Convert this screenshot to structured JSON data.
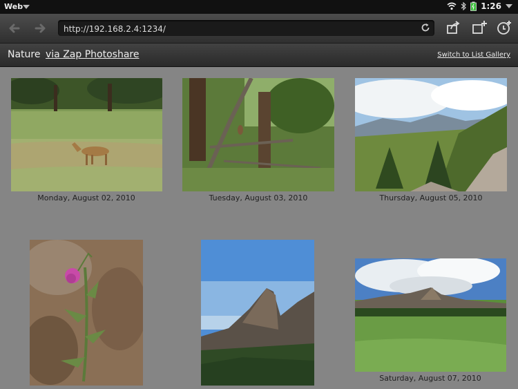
{
  "status": {
    "app_name": "Web",
    "time": "1:26"
  },
  "toolbar": {
    "url": "http://192.168.2.4:1234/"
  },
  "header": {
    "title": "Nature",
    "via_link": "via Zap Photoshare",
    "switch_link": "Switch to List Gallery"
  },
  "gallery": {
    "photos": [
      {
        "caption": "Monday, August 02, 2010",
        "subject": "deer in grassy meadow"
      },
      {
        "caption": "Tuesday, August 03, 2010",
        "subject": "bird on pine branch"
      },
      {
        "caption": "Thursday, August 05, 2010",
        "subject": "mountain vista with rocks"
      },
      {
        "caption": "",
        "subject": "purple thistle flower"
      },
      {
        "caption": "",
        "subject": "rock formation against blue sky"
      },
      {
        "caption": "Saturday, August 07, 2010",
        "subject": "green meadow and flatirons"
      }
    ]
  },
  "colors": {
    "background": "#858585",
    "toolbar": "#3a3a3a",
    "status": "#111111"
  }
}
